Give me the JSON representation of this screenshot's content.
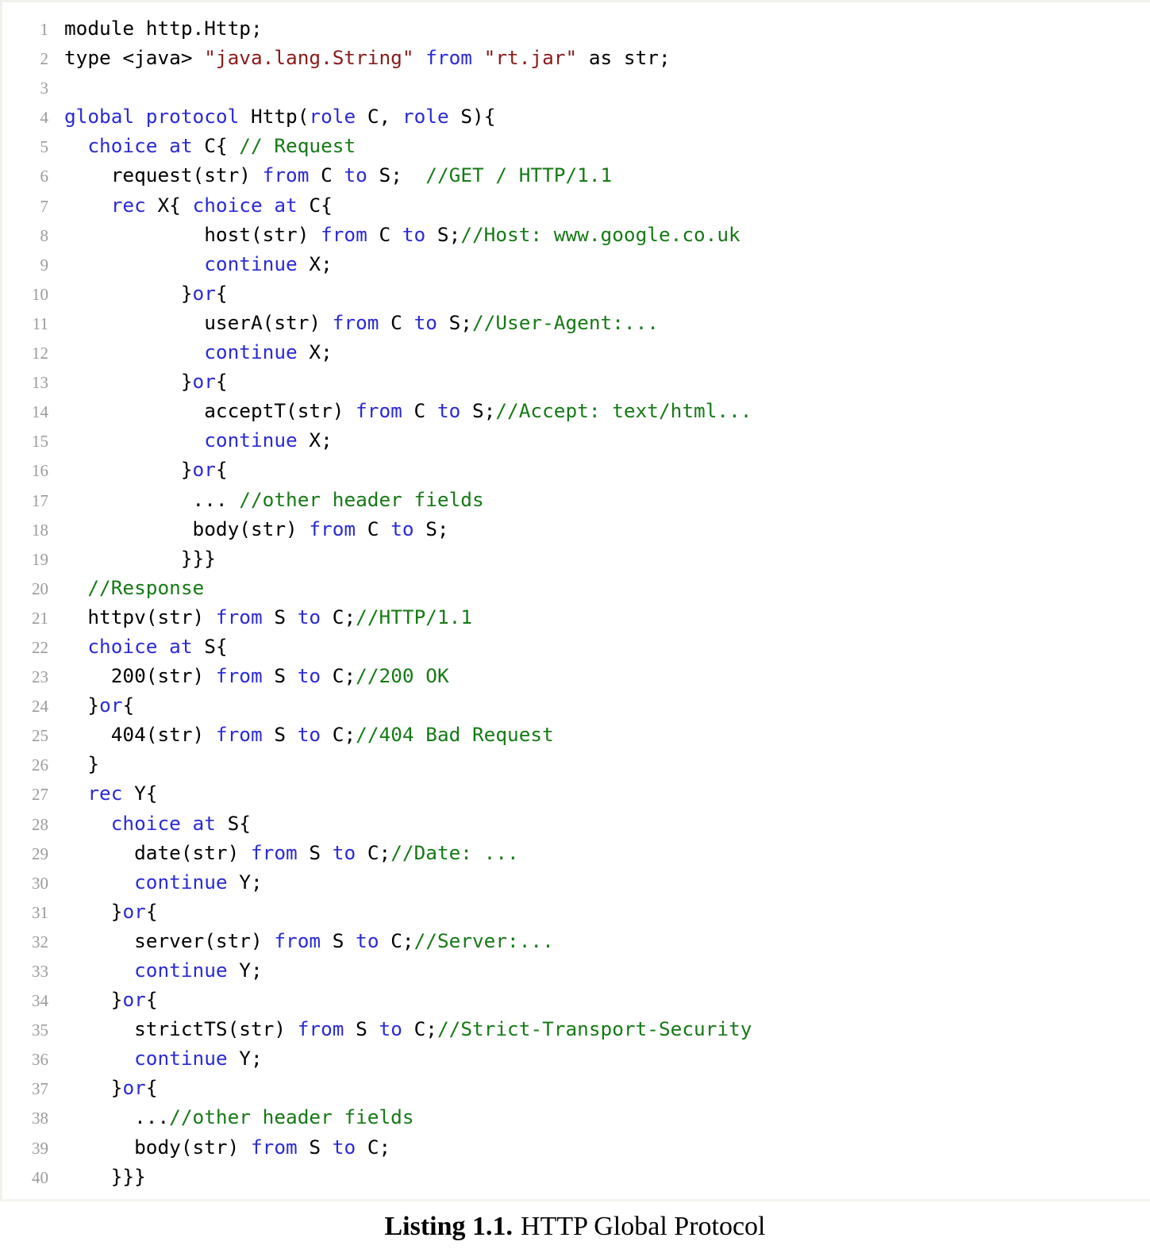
{
  "listing": {
    "caption_label": "Listing 1.1.",
    "caption_title": "HTTP Global Protocol",
    "language": "Scribble",
    "colors": {
      "keyword": "#2a2ad6",
      "comment": "#157a15",
      "string": "#8b1a1a",
      "plain": "#000000",
      "line_number": "#9b9b9b",
      "background": "#ffffff",
      "frame": "#f1f1ec"
    },
    "first_line_number": 1,
    "last_line_number": 40,
    "lines": [
      {
        "n": "1",
        "tokens": [
          {
            "t": "module http.Http;",
            "c": "plain"
          }
        ]
      },
      {
        "n": "2",
        "tokens": [
          {
            "t": "type <java> ",
            "c": "plain"
          },
          {
            "t": "\"java.lang.String\"",
            "c": "str"
          },
          {
            "t": " ",
            "c": "plain"
          },
          {
            "t": "from",
            "c": "kw"
          },
          {
            "t": " ",
            "c": "plain"
          },
          {
            "t": "\"rt.jar\"",
            "c": "str"
          },
          {
            "t": " as str;",
            "c": "plain"
          }
        ]
      },
      {
        "n": "3",
        "tokens": [
          {
            "t": "",
            "c": "plain"
          }
        ]
      },
      {
        "n": "4",
        "tokens": [
          {
            "t": "global protocol",
            "c": "kw"
          },
          {
            "t": " Http(",
            "c": "plain"
          },
          {
            "t": "role",
            "c": "kw"
          },
          {
            "t": " C, ",
            "c": "plain"
          },
          {
            "t": "role",
            "c": "kw"
          },
          {
            "t": " S){",
            "c": "plain"
          }
        ]
      },
      {
        "n": "5",
        "tokens": [
          {
            "t": "  ",
            "c": "plain"
          },
          {
            "t": "choice at",
            "c": "kw"
          },
          {
            "t": " C{ ",
            "c": "plain"
          },
          {
            "t": "// Request",
            "c": "cmt"
          }
        ]
      },
      {
        "n": "6",
        "tokens": [
          {
            "t": "    request(str) ",
            "c": "plain"
          },
          {
            "t": "from",
            "c": "kw"
          },
          {
            "t": " C ",
            "c": "plain"
          },
          {
            "t": "to",
            "c": "kw"
          },
          {
            "t": " S;  ",
            "c": "plain"
          },
          {
            "t": "//GET / HTTP/1.1",
            "c": "cmt"
          }
        ]
      },
      {
        "n": "7",
        "tokens": [
          {
            "t": "    ",
            "c": "plain"
          },
          {
            "t": "rec",
            "c": "kw"
          },
          {
            "t": " X{ ",
            "c": "plain"
          },
          {
            "t": "choice at",
            "c": "kw"
          },
          {
            "t": " C{",
            "c": "plain"
          }
        ]
      },
      {
        "n": "8",
        "tokens": [
          {
            "t": "            host(str) ",
            "c": "plain"
          },
          {
            "t": "from",
            "c": "kw"
          },
          {
            "t": " C ",
            "c": "plain"
          },
          {
            "t": "to",
            "c": "kw"
          },
          {
            "t": " S;",
            "c": "plain"
          },
          {
            "t": "//Host: www.google.co.uk",
            "c": "cmt"
          }
        ]
      },
      {
        "n": "9",
        "tokens": [
          {
            "t": "            ",
            "c": "plain"
          },
          {
            "t": "continue",
            "c": "kw"
          },
          {
            "t": " X;",
            "c": "plain"
          }
        ]
      },
      {
        "n": "10",
        "tokens": [
          {
            "t": "          }",
            "c": "plain"
          },
          {
            "t": "or",
            "c": "kw"
          },
          {
            "t": "{",
            "c": "plain"
          }
        ]
      },
      {
        "n": "11",
        "tokens": [
          {
            "t": "            userA(str) ",
            "c": "plain"
          },
          {
            "t": "from",
            "c": "kw"
          },
          {
            "t": " C ",
            "c": "plain"
          },
          {
            "t": "to",
            "c": "kw"
          },
          {
            "t": " S;",
            "c": "plain"
          },
          {
            "t": "//User-Agent:...",
            "c": "cmt"
          }
        ]
      },
      {
        "n": "12",
        "tokens": [
          {
            "t": "            ",
            "c": "plain"
          },
          {
            "t": "continue",
            "c": "kw"
          },
          {
            "t": " X;",
            "c": "plain"
          }
        ]
      },
      {
        "n": "13",
        "tokens": [
          {
            "t": "          }",
            "c": "plain"
          },
          {
            "t": "or",
            "c": "kw"
          },
          {
            "t": "{",
            "c": "plain"
          }
        ]
      },
      {
        "n": "14",
        "tokens": [
          {
            "t": "            acceptT(str) ",
            "c": "plain"
          },
          {
            "t": "from",
            "c": "kw"
          },
          {
            "t": " C ",
            "c": "plain"
          },
          {
            "t": "to",
            "c": "kw"
          },
          {
            "t": " S;",
            "c": "plain"
          },
          {
            "t": "//Accept: text/html...",
            "c": "cmt"
          }
        ]
      },
      {
        "n": "15",
        "tokens": [
          {
            "t": "            ",
            "c": "plain"
          },
          {
            "t": "continue",
            "c": "kw"
          },
          {
            "t": " X;",
            "c": "plain"
          }
        ]
      },
      {
        "n": "16",
        "tokens": [
          {
            "t": "          }",
            "c": "plain"
          },
          {
            "t": "or",
            "c": "kw"
          },
          {
            "t": "{",
            "c": "plain"
          }
        ]
      },
      {
        "n": "17",
        "tokens": [
          {
            "t": "           ... ",
            "c": "plain"
          },
          {
            "t": "//other header fields",
            "c": "cmt"
          }
        ]
      },
      {
        "n": "18",
        "tokens": [
          {
            "t": "           body(str) ",
            "c": "plain"
          },
          {
            "t": "from",
            "c": "kw"
          },
          {
            "t": " C ",
            "c": "plain"
          },
          {
            "t": "to",
            "c": "kw"
          },
          {
            "t": " S;",
            "c": "plain"
          }
        ]
      },
      {
        "n": "19",
        "tokens": [
          {
            "t": "          }}}",
            "c": "plain"
          }
        ]
      },
      {
        "n": "20",
        "tokens": [
          {
            "t": "  ",
            "c": "plain"
          },
          {
            "t": "//Response",
            "c": "cmt"
          }
        ]
      },
      {
        "n": "21",
        "tokens": [
          {
            "t": "  httpv(str) ",
            "c": "plain"
          },
          {
            "t": "from",
            "c": "kw"
          },
          {
            "t": " S ",
            "c": "plain"
          },
          {
            "t": "to",
            "c": "kw"
          },
          {
            "t": " C;",
            "c": "plain"
          },
          {
            "t": "//HTTP/1.1",
            "c": "cmt"
          }
        ]
      },
      {
        "n": "22",
        "tokens": [
          {
            "t": "  ",
            "c": "plain"
          },
          {
            "t": "choice at",
            "c": "kw"
          },
          {
            "t": " S{",
            "c": "plain"
          }
        ]
      },
      {
        "n": "23",
        "tokens": [
          {
            "t": "    200(str) ",
            "c": "plain"
          },
          {
            "t": "from",
            "c": "kw"
          },
          {
            "t": " S ",
            "c": "plain"
          },
          {
            "t": "to",
            "c": "kw"
          },
          {
            "t": " C;",
            "c": "plain"
          },
          {
            "t": "//200 OK",
            "c": "cmt"
          }
        ]
      },
      {
        "n": "24",
        "tokens": [
          {
            "t": "  }",
            "c": "plain"
          },
          {
            "t": "or",
            "c": "kw"
          },
          {
            "t": "{",
            "c": "plain"
          }
        ]
      },
      {
        "n": "25",
        "tokens": [
          {
            "t": "    404(str) ",
            "c": "plain"
          },
          {
            "t": "from",
            "c": "kw"
          },
          {
            "t": " S ",
            "c": "plain"
          },
          {
            "t": "to",
            "c": "kw"
          },
          {
            "t": " C;",
            "c": "plain"
          },
          {
            "t": "//404 Bad Request",
            "c": "cmt"
          }
        ]
      },
      {
        "n": "26",
        "tokens": [
          {
            "t": "  }",
            "c": "plain"
          }
        ]
      },
      {
        "n": "27",
        "tokens": [
          {
            "t": "  ",
            "c": "plain"
          },
          {
            "t": "rec",
            "c": "kw"
          },
          {
            "t": " Y{",
            "c": "plain"
          }
        ]
      },
      {
        "n": "28",
        "tokens": [
          {
            "t": "    ",
            "c": "plain"
          },
          {
            "t": "choice at",
            "c": "kw"
          },
          {
            "t": " S{",
            "c": "plain"
          }
        ]
      },
      {
        "n": "29",
        "tokens": [
          {
            "t": "      date(str) ",
            "c": "plain"
          },
          {
            "t": "from",
            "c": "kw"
          },
          {
            "t": " S ",
            "c": "plain"
          },
          {
            "t": "to",
            "c": "kw"
          },
          {
            "t": " C;",
            "c": "plain"
          },
          {
            "t": "//Date: ...",
            "c": "cmt"
          }
        ]
      },
      {
        "n": "30",
        "tokens": [
          {
            "t": "      ",
            "c": "plain"
          },
          {
            "t": "continue",
            "c": "kw"
          },
          {
            "t": " Y;",
            "c": "plain"
          }
        ]
      },
      {
        "n": "31",
        "tokens": [
          {
            "t": "    }",
            "c": "plain"
          },
          {
            "t": "or",
            "c": "kw"
          },
          {
            "t": "{",
            "c": "plain"
          }
        ]
      },
      {
        "n": "32",
        "tokens": [
          {
            "t": "      server(str) ",
            "c": "plain"
          },
          {
            "t": "from",
            "c": "kw"
          },
          {
            "t": " S ",
            "c": "plain"
          },
          {
            "t": "to",
            "c": "kw"
          },
          {
            "t": " C;",
            "c": "plain"
          },
          {
            "t": "//Server:...",
            "c": "cmt"
          }
        ]
      },
      {
        "n": "33",
        "tokens": [
          {
            "t": "      ",
            "c": "plain"
          },
          {
            "t": "continue",
            "c": "kw"
          },
          {
            "t": " Y;",
            "c": "plain"
          }
        ]
      },
      {
        "n": "34",
        "tokens": [
          {
            "t": "    }",
            "c": "plain"
          },
          {
            "t": "or",
            "c": "kw"
          },
          {
            "t": "{",
            "c": "plain"
          }
        ]
      },
      {
        "n": "35",
        "tokens": [
          {
            "t": "      strictTS(str) ",
            "c": "plain"
          },
          {
            "t": "from",
            "c": "kw"
          },
          {
            "t": " S ",
            "c": "plain"
          },
          {
            "t": "to",
            "c": "kw"
          },
          {
            "t": " C;",
            "c": "plain"
          },
          {
            "t": "//Strict-Transport-Security",
            "c": "cmt"
          }
        ]
      },
      {
        "n": "36",
        "tokens": [
          {
            "t": "      ",
            "c": "plain"
          },
          {
            "t": "continue",
            "c": "kw"
          },
          {
            "t": " Y;",
            "c": "plain"
          }
        ]
      },
      {
        "n": "37",
        "tokens": [
          {
            "t": "    }",
            "c": "plain"
          },
          {
            "t": "or",
            "c": "kw"
          },
          {
            "t": "{",
            "c": "plain"
          }
        ]
      },
      {
        "n": "38",
        "tokens": [
          {
            "t": "      ...",
            "c": "plain"
          },
          {
            "t": "//other header fields",
            "c": "cmt"
          }
        ]
      },
      {
        "n": "39",
        "tokens": [
          {
            "t": "      body(str) ",
            "c": "plain"
          },
          {
            "t": "from",
            "c": "kw"
          },
          {
            "t": " S ",
            "c": "plain"
          },
          {
            "t": "to",
            "c": "kw"
          },
          {
            "t": " C;",
            "c": "plain"
          }
        ]
      },
      {
        "n": "40",
        "tokens": [
          {
            "t": "    }}}",
            "c": "plain"
          }
        ]
      }
    ]
  }
}
